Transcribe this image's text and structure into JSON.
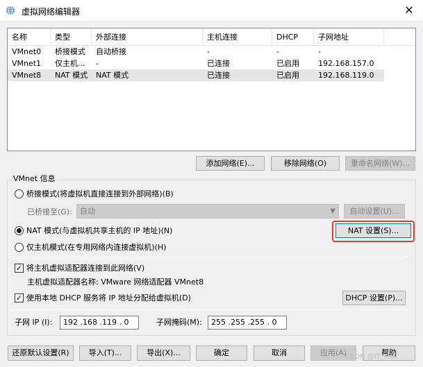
{
  "window": {
    "title": "虚拟网络编辑器",
    "close_glyph": "✕"
  },
  "table": {
    "columns": [
      "名称",
      "类型",
      "外部连接",
      "主机连接",
      "DHCP",
      "子网地址"
    ],
    "rows": [
      [
        "VMnet0",
        "桥接模式",
        "自动桥接",
        "-",
        "-",
        "-"
      ],
      [
        "VMnet1",
        "仅主机...",
        "-",
        "已连接",
        "已启用",
        "192.168.157.0"
      ],
      [
        "VMnet8",
        "NAT 模式",
        "NAT 模式",
        "已连接",
        "已启用",
        "192.168.119.0"
      ]
    ],
    "selected_row": 2
  },
  "network_buttons": {
    "add": "添加网络(E)...",
    "remove": "移除网络(O)",
    "rename": "重命名网络(W)..."
  },
  "vmnet_info": {
    "group_label": "VMnet 信息",
    "bridged_label": "桥接模式(将虚拟机直接连接到外部网络)(B)",
    "bridged_to_label": "已桥接至(G):",
    "bridged_to_value": "自动",
    "auto_settings": "自动设置(U)...",
    "nat_label": "NAT 模式(与虚拟机共享主机的 IP 地址)(N)",
    "nat_settings": "NAT 设置(S)...",
    "hostonly_label": "仅主机模式(在专用网络内连接虚拟机)(H)",
    "selected_mode": "nat",
    "connect_adapter_label": "将主机虚拟适配器连接到此网络(V)",
    "connect_adapter_checked": true,
    "adapter_name_label": "主机虚拟适配器名称: VMware 网络适配器 VMnet8",
    "dhcp_label": "使用本地 DHCP 服务将 IP 地址分配给虚拟机(D)",
    "dhcp_checked": true,
    "dhcp_settings": "DHCP 设置(P)...",
    "subnet_ip_label": "子网 IP (I):",
    "subnet_ip_value": "192 .168 .119 . 0",
    "subnet_mask_label": "子网掩码(M):",
    "subnet_mask_value": "255 .255 .255 . 0"
  },
  "footer": {
    "restore": "还原默认设置(R)",
    "import": "导入(T)...",
    "export": "导出(X)...",
    "ok": "确定",
    "cancel": "取消",
    "apply": "应用(A)",
    "help": "帮助"
  },
  "watermark": "CSDN @IT_MIN",
  "colors": {
    "highlight": "#e5392f",
    "selected_row": "#e5e5e5",
    "accent": "#0078d7"
  }
}
